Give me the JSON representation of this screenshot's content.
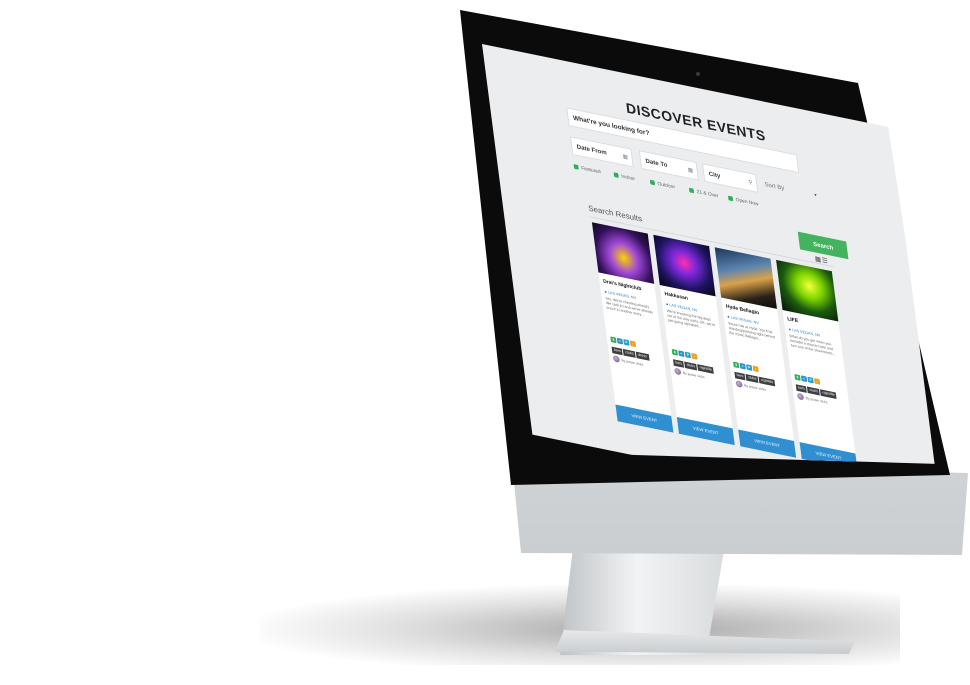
{
  "page": {
    "title": "DISCOVER EVENTS"
  },
  "search": {
    "placeholder": "What're you looking for?",
    "date_from": "Date From",
    "date_to": "Date To",
    "city": "City",
    "sort_by": "Sort By",
    "button": "Search"
  },
  "filters": [
    "Featured",
    "Indoor",
    "Outdoor",
    "21 & Over",
    "Open Now"
  ],
  "results": {
    "title": "Search Results"
  },
  "cards": [
    {
      "name": "Drai's Nightclub",
      "location": "LAS VEGAS, NV",
      "desc": "Yes. We're cheating already. We said 10 and we've already snuck in another entry...",
      "tags": [
        "bars",
        "clubs",
        "dress"
      ],
      "author": "By jessie vicks",
      "button": "VIEW EVENT"
    },
    {
      "name": "Hakkasan",
      "location": "LAS VEGAS, NV",
      "desc": "We're knocking the big dogs out of the way early. OK, we're just going alphabeti...",
      "tags": [
        "bars",
        "clubs",
        "nightlife"
      ],
      "author": "By jessie vicks",
      "button": "VIEW EVENT"
    },
    {
      "name": "Hyde Bellagio",
      "location": "LAS VEGAS, NV",
      "desc": "Views rule at Hyde. You'll be standing/partying right behind the iconic Bellagio...",
      "tags": [
        "bars",
        "clubs",
        "nightlife"
      ],
      "author": "By jessie vicks",
      "button": "VIEW EVENT"
    },
    {
      "name": "LIFE",
      "location": "LAS VEGAS, NV",
      "desc": "What do you get when you remodel a classic hotel and turn one of the showrooms...",
      "tags": [
        "bars",
        "clubs",
        "nightlife"
      ],
      "author": "By jessie vicks",
      "button": "VIEW EVENT"
    }
  ],
  "colors": {
    "accent_green": "#43b35f",
    "accent_blue": "#2f8fd1",
    "badge_colors": [
      "#2eb05a",
      "#2f8fd1",
      "#27a0c8",
      "#f0a020"
    ]
  }
}
